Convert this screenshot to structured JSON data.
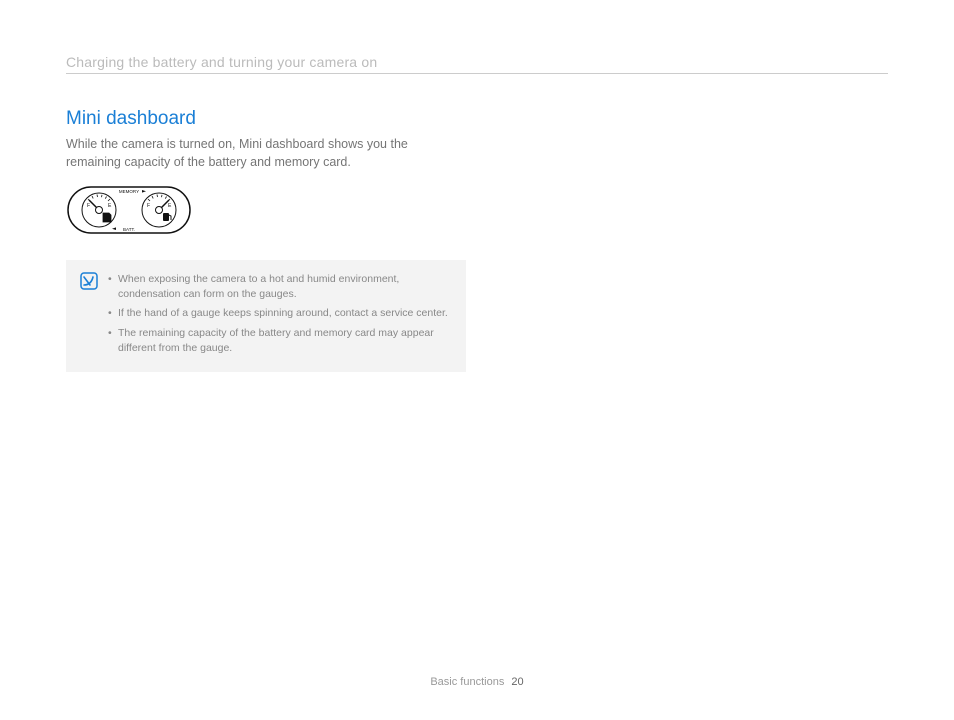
{
  "header": {
    "breadcrumb": "Charging the battery and turning your camera on"
  },
  "section": {
    "heading": "Mini dashboard",
    "intro": "While the camera is turned on, Mini dashboard shows you the remaining capacity of the battery and memory card."
  },
  "gauge": {
    "label_top": "MEMORY",
    "label_bottom": "BATT.",
    "left_full": "F",
    "left_empty": "E",
    "right_full": "F",
    "right_empty": "E"
  },
  "notes": {
    "items": [
      "When exposing the camera to a hot and humid environment, condensation can form on the gauges.",
      "If the hand of a gauge keeps spinning around, contact a service center.",
      "The remaining capacity of the battery and memory card may appear different from the gauge."
    ]
  },
  "footer": {
    "section_name": "Basic functions",
    "page_number": "20"
  }
}
